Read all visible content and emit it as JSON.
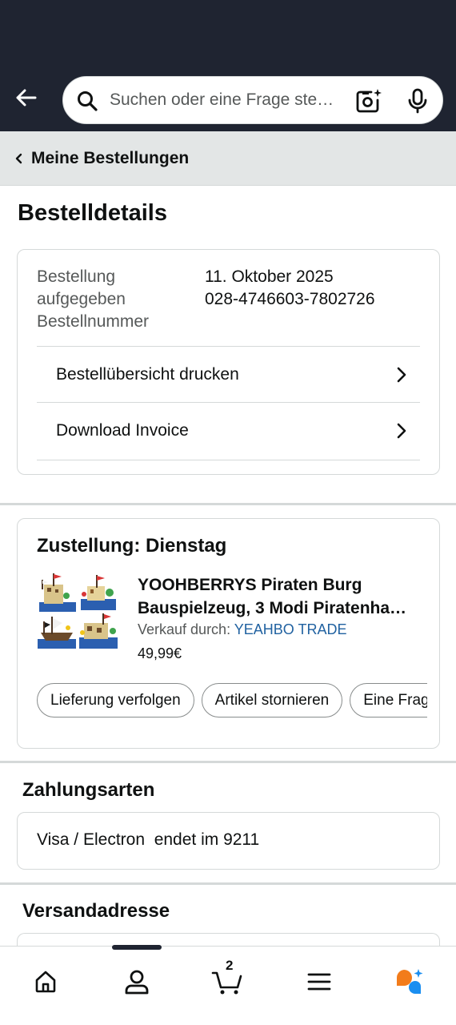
{
  "search": {
    "placeholder": "Suchen oder eine Frage ste…"
  },
  "breadcrumb": {
    "label": "Meine Bestellungen"
  },
  "page": {
    "title": "Bestelldetails"
  },
  "order": {
    "label_placed": "Bestellung aufgegeben",
    "label_number": "Bestellnummer",
    "date": "11. Oktober 2025",
    "number": "028-4746603-7802726",
    "print_summary": "Bestellübersicht drucken",
    "download_invoice": "Download Invoice"
  },
  "delivery": {
    "title": "Zustellung: Dienstag",
    "product_title_line1": "YOOHBERRYS Piraten Burg",
    "product_title_line2": "Bauspielzeug, 3 Modi Piratenha…",
    "seller_prefix": "Verkauf durch:",
    "seller_name": "YEAHBO TRADE",
    "price": "49,99€",
    "actions": [
      "Lieferung verfolgen",
      "Artikel stornieren",
      "Eine Frage"
    ]
  },
  "payment": {
    "heading": "Zahlungsarten",
    "method": "Visa / Electron",
    "ending": "endet im 9211"
  },
  "shipping": {
    "heading": "Versandadresse"
  },
  "nav": {
    "items": [
      "home-icon",
      "account-icon",
      "cart-icon",
      "menu-icon",
      "rufus-icon"
    ],
    "cart_count": "2",
    "active_index": 1
  },
  "colors": {
    "header_bg": "#1f2431",
    "breadcrumb_bg": "#e3e6e6",
    "link": "#2162a1",
    "rufus_orange": "#f27c1b",
    "rufus_blue": "#1a8ef0"
  }
}
